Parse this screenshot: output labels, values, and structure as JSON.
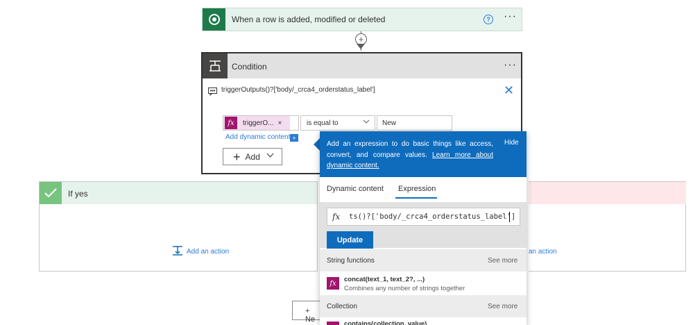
{
  "trigger": {
    "title": "When a row is added, modified or deleted",
    "help_icon": "help-circle-icon",
    "more": "···"
  },
  "connector": {
    "plus": "+"
  },
  "condition": {
    "title": "Condition",
    "more": "···",
    "expression_label": "triggerOutputs()?['body/_crca4_orderstatus_label']",
    "close": "✕",
    "token_icon": "fx",
    "token_label": "triggerO...",
    "token_remove": "×",
    "operator": "is equal to",
    "value": "New",
    "add_dynamic": "Add dynamic content",
    "add_dynamic_badge": "+",
    "add_button": "Add"
  },
  "if_yes": {
    "title": "If yes",
    "add_action": "Add an action"
  },
  "if_no": {
    "add_action": "an action"
  },
  "new_step": "+ Ne",
  "popup": {
    "info_text": "Add an expression to do basic things like access, convert, and compare values. ",
    "learn_more": "Learn more about dynamic content.",
    "hide": "Hide",
    "tabs": [
      "Dynamic content",
      "Expression"
    ],
    "active_tab": "Expression",
    "expression_icon": "fx",
    "expression_value": "ts()?['body/_crca4_orderstatus_label']",
    "update_button": "Update",
    "sections": [
      {
        "title": "String functions",
        "see_more": "See more"
      },
      {
        "title": "Collection",
        "see_more": "See more"
      }
    ],
    "functions": [
      {
        "name": "concat(text_1, text_2?, ...)",
        "description": "Combines any number of strings together"
      },
      {
        "name": "contains(collection, value)"
      }
    ]
  },
  "colors": {
    "accent": "#0f6cbd",
    "function_magenta": "#a0156d",
    "dataverse_green": "#1e7a4a",
    "yes_green": "#77c47e",
    "no_red_bg": "#fde7e9"
  }
}
